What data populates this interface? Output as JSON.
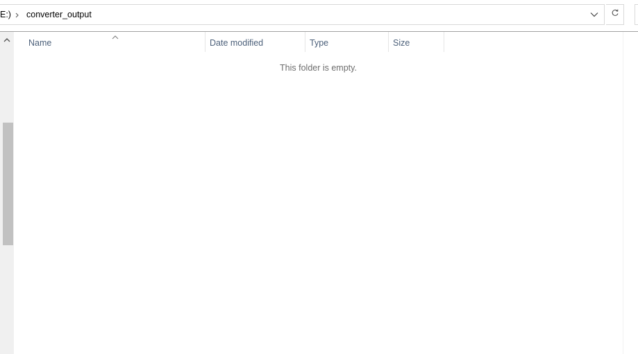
{
  "address_bar": {
    "drive_fragment": "E:)",
    "current_folder": "converter_output",
    "separator_icon": "chevron-right-icon",
    "dropdown_icon": "chevron-down-icon",
    "refresh_icon": "refresh-icon"
  },
  "columns": [
    {
      "label": "Name"
    },
    {
      "label": "Date modified"
    },
    {
      "label": "Type"
    },
    {
      "label": "Size"
    }
  ],
  "sort": {
    "column": "Name",
    "icon": "sort-ascending-icon"
  },
  "file_list": {
    "empty_message": "This folder is empty."
  },
  "nav_pane": {
    "scroll_up_icon": "scroll-up-arrow-icon"
  },
  "colors": {
    "header_text": "#4c607a",
    "empty_text": "#6d6d6d",
    "scrollbar_track": "#f0f0f0",
    "scrollbar_thumb": "#c1c1c1",
    "border": "#d9d9d9"
  }
}
